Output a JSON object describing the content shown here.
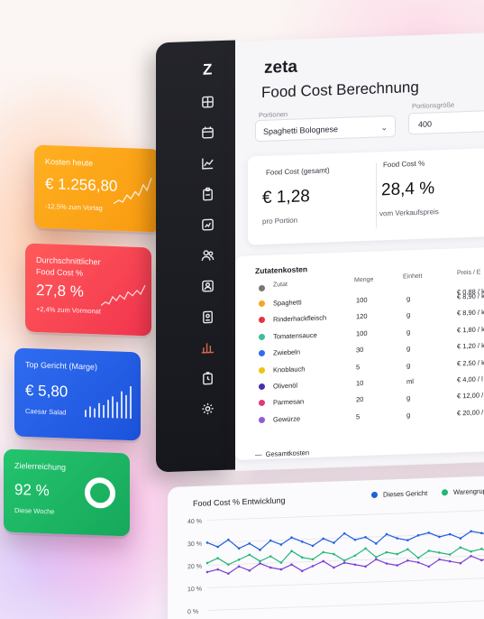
{
  "kpis": {
    "today": {
      "title": "Kosten heute",
      "value": "€ 1.256,80",
      "sub": "-12,5% zum Vortag",
      "color": "#f99a10"
    },
    "avg": {
      "title_line1": "Durchschnittlicher",
      "title_line2": "Food Cost %",
      "value": "27,8 %",
      "sub": "+2,4% zum Vormonat",
      "color": "#f2344e"
    },
    "top": {
      "title": "Top Gericht (Marge)",
      "value": "€ 5,80",
      "sub": "Caesar Salad",
      "color": "#1c53dc"
    },
    "goal": {
      "title": "Zielerreichung",
      "value": "92 %",
      "sub": "Diese Woche",
      "color": "#16a85b"
    }
  },
  "sidebar": {
    "logo": "Z",
    "items": [
      {
        "icon": "calculator-icon"
      },
      {
        "icon": "calendar-icon"
      },
      {
        "icon": "chart-icon"
      },
      {
        "icon": "clipboard-icon"
      },
      {
        "icon": "report-icon"
      },
      {
        "icon": "users-icon"
      },
      {
        "icon": "team-icon"
      },
      {
        "icon": "id-card-icon"
      },
      {
        "icon": "analytics-icon",
        "active": true
      },
      {
        "icon": "timer-icon"
      },
      {
        "icon": "settings-icon"
      }
    ]
  },
  "app": {
    "brand": "zeta",
    "page_title": "Food Cost Berechnung",
    "recipe_label": "Portionen",
    "recipe_value": "Spaghetti Bolognese",
    "portion_label": "Portionsgröße",
    "portion_value": "400",
    "food_cost_total_label": "Food Cost (gesamt)",
    "food_cost_total_value": "€ 1,28",
    "food_cost_total_sub": "pro Portion",
    "food_cost_pct_label": "Food Cost %",
    "food_cost_pct_value": "28,4 %",
    "food_cost_pct_sub": "vom Verkaufspreis"
  },
  "table": {
    "title": "Zutatenkosten",
    "headers": [
      "Zutat",
      "Menge",
      "Einheit",
      "Preis / E"
    ],
    "rows": [
      {
        "name": "Spaghetti",
        "qty": "100",
        "unit": "g",
        "price": "€ 8,90 / k",
        "color": "#f5a623"
      },
      {
        "name": "Rinderhackfleisch",
        "qty": "120",
        "unit": "g",
        "price": "€ 8,90 / k",
        "color": "#e8323e"
      },
      {
        "name": "Tomatensauce",
        "qty": "100",
        "unit": "g",
        "price": "€ 1,80 / k",
        "color": "#3cbf9a"
      },
      {
        "name": "Zwiebeln",
        "qty": "30",
        "unit": "g",
        "price": "€ 1,20 / k",
        "color": "#2f6cf0"
      },
      {
        "name": "Knoblauch",
        "qty": "5",
        "unit": "g",
        "price": "€ 2,50 / k",
        "color": "#f1c40f"
      },
      {
        "name": "Olivenöl",
        "qty": "10",
        "unit": "ml",
        "price": "€ 4,00 / l",
        "color": "#4b2fa8"
      },
      {
        "name": "Parmesan",
        "qty": "20",
        "unit": "g",
        "price": "€ 12,00 / k",
        "color": "#e03a7c"
      },
      {
        "name": "Gewürze",
        "qty": "5",
        "unit": "g",
        "price": "€ 20,00 / k",
        "color": "#8e5bd9"
      }
    ],
    "header_price_first": "€ 0,88 / k",
    "total_label": "Gesamtkosten"
  },
  "chart": {
    "title": "Food Cost % Entwicklung",
    "legend": [
      {
        "name": "Dieses Gericht",
        "color": "#1f5fe0"
      },
      {
        "name": "Warengrup",
        "color": "#22b779"
      }
    ]
  },
  "chart_data": {
    "type": "line",
    "yticks": [
      "40 %",
      "30 %",
      "20 %",
      "10 %",
      "0 %"
    ],
    "ylim": [
      0,
      40
    ],
    "series": [
      {
        "name": "Dieses Gericht",
        "color": "#1f5fe0",
        "values": [
          30,
          28,
          31,
          27,
          29,
          26,
          30,
          28,
          31,
          29,
          27,
          30,
          28,
          32,
          29,
          30,
          27,
          31,
          29,
          28,
          30,
          31,
          29,
          30,
          28,
          31,
          30,
          29
        ]
      },
      {
        "name": "Warengrup",
        "color": "#22b779",
        "values": [
          21,
          23,
          20,
          22,
          24,
          21,
          23,
          20,
          25,
          22,
          21,
          24,
          23,
          20,
          22,
          25,
          21,
          23,
          22,
          24,
          20,
          23,
          22,
          21,
          24,
          22,
          23,
          21
        ]
      },
      {
        "values": [
          17,
          18,
          16,
          19,
          17,
          20,
          18,
          17,
          19,
          16,
          18,
          20,
          17,
          19,
          18,
          17,
          20,
          18,
          17,
          19,
          18,
          16,
          19,
          18,
          17,
          20,
          18,
          19
        ],
        "color": "#7b3fd6"
      }
    ]
  }
}
